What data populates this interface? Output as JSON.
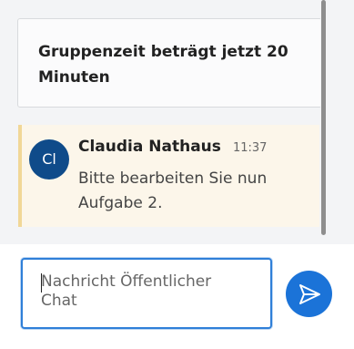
{
  "system_message": {
    "text": "Gruppenzeit beträgt jetzt 20 Minuten"
  },
  "message": {
    "avatar_initials": "Cl",
    "author": "Claudia Nathaus",
    "time": "11:37",
    "text": "Bitte bearbeiten Sie nun Aufgabe 2."
  },
  "composer": {
    "placeholder": "Nachricht Öffentlicher Chat",
    "value": ""
  },
  "send_button": {
    "icon": "send-icon"
  },
  "colors": {
    "accent": "#1b73d8",
    "avatar_bg": "#0f4b8a",
    "message_bg": "#fcf6ea",
    "message_border": "#f1d797"
  }
}
